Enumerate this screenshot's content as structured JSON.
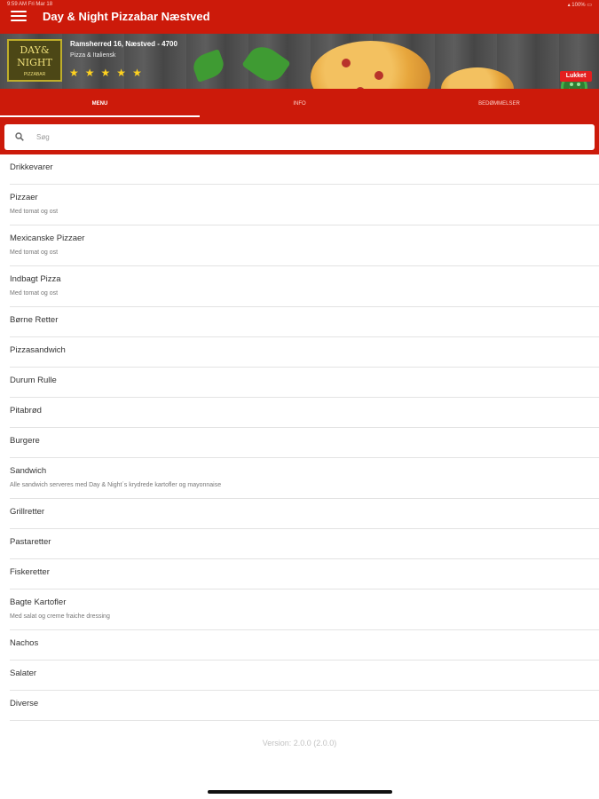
{
  "status_bar": {
    "time": "9:59 AM",
    "date": "Fri Mar 18",
    "battery": "100%"
  },
  "header": {
    "title": "Day & Night Pizzabar Næstved",
    "menu_icon": "hamburger-menu-icon"
  },
  "restaurant": {
    "logo_text": [
      "DAY&",
      "NIGHT"
    ],
    "logo_sub": "PIZZABAR",
    "address": "Ramsherred 16, Næstved - 4700",
    "cuisine": "Pizza & Italiensk",
    "rating": 5,
    "stars": [
      "★",
      "★",
      "★",
      "★",
      "★"
    ],
    "status_label": "Lukket"
  },
  "tabs": [
    {
      "label": "MENU",
      "active": true
    },
    {
      "label": "INFO",
      "active": false
    },
    {
      "label": "BEDØMMELSER",
      "active": false
    }
  ],
  "search": {
    "placeholder": "Søg",
    "value": ""
  },
  "categories": [
    {
      "title": "Drikkevarer",
      "subtitle": ""
    },
    {
      "title": "Pizzaer",
      "subtitle": "Med tomat og ost"
    },
    {
      "title": "Mexicanske Pizzaer",
      "subtitle": "Med tomat og ost"
    },
    {
      "title": "Indbagt Pizza",
      "subtitle": "Med tomat og ost"
    },
    {
      "title": "Børne Retter",
      "subtitle": ""
    },
    {
      "title": "Pizzasandwich",
      "subtitle": ""
    },
    {
      "title": "Durum Rulle",
      "subtitle": ""
    },
    {
      "title": "Pitabrød",
      "subtitle": ""
    },
    {
      "title": "Burgere",
      "subtitle": ""
    },
    {
      "title": "Sandwich",
      "subtitle": "Alle sandwich serveres med Day & Night´s krydrede kartofler og mayonnaise"
    },
    {
      "title": "Grillretter",
      "subtitle": ""
    },
    {
      "title": "Pastaretter",
      "subtitle": ""
    },
    {
      "title": "Fiskeretter",
      "subtitle": ""
    },
    {
      "title": "Bagte Kartofler",
      "subtitle": "Med salat og creme fraiche dressing"
    },
    {
      "title": "Nachos",
      "subtitle": ""
    },
    {
      "title": "Salater",
      "subtitle": ""
    },
    {
      "title": "Diverse",
      "subtitle": ""
    }
  ],
  "footer": {
    "version": "Version: 2.0.0 (2.0.0)"
  },
  "colors": {
    "primary": "#cc1a0a",
    "star": "#ffd21f",
    "closed_badge": "#e41f1f",
    "smiley": "#43b24a"
  }
}
